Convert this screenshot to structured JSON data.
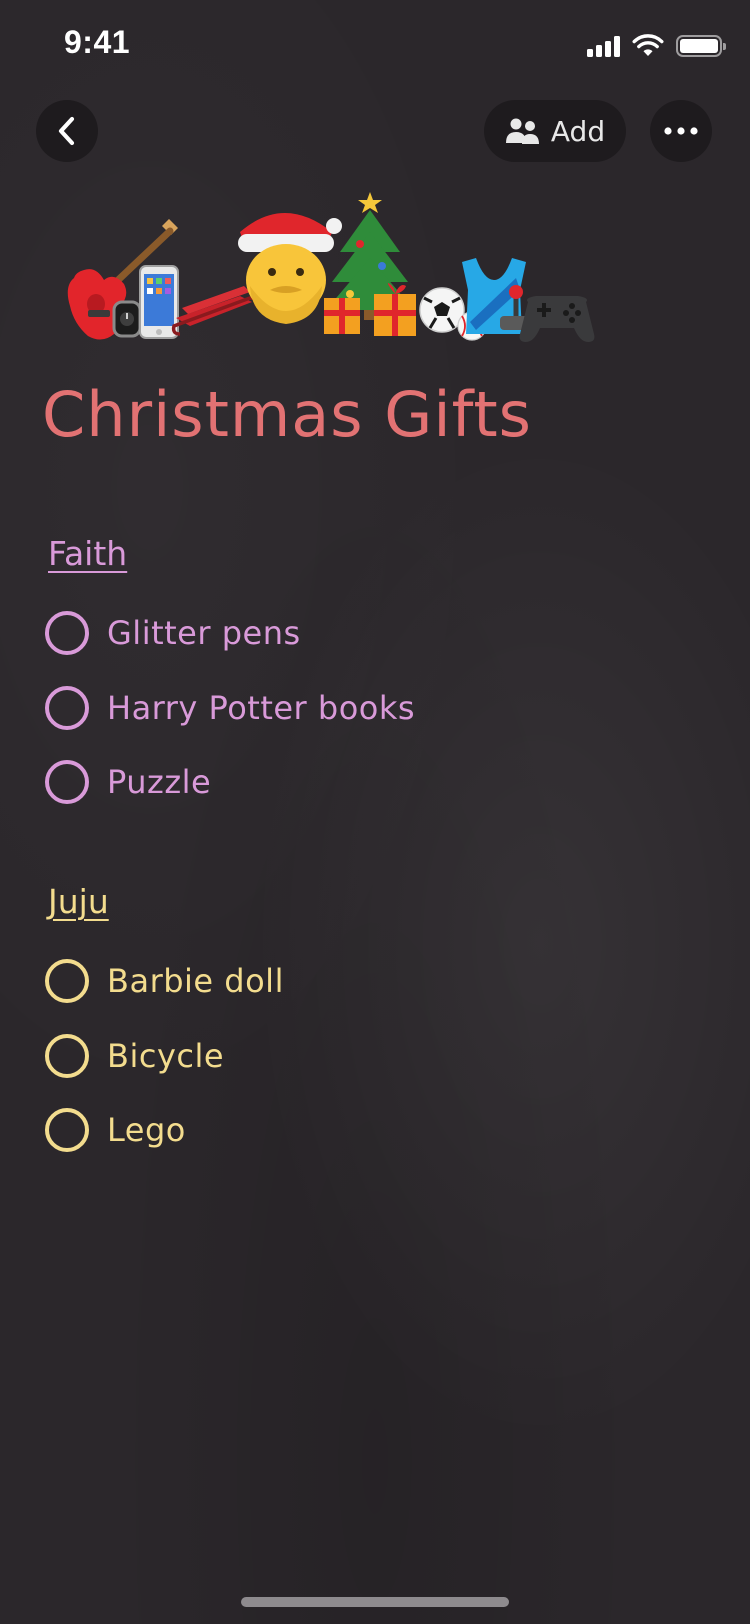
{
  "status_bar": {
    "time": "9:41"
  },
  "nav": {
    "back_icon": "chevron-left-icon",
    "add_icon": "people-icon",
    "add_label": "Add",
    "more_icon": "ellipsis-icon"
  },
  "banner": {
    "emojis": [
      "guitar",
      "watch",
      "mobile-phone",
      "sled",
      "santa-face",
      "christmas-tree",
      "wrapped-gifts",
      "soccer-ball",
      "baseball",
      "tank-top",
      "joystick",
      "video-game-controller"
    ]
  },
  "note": {
    "title": "Christmas Gifts",
    "colors": {
      "title": "#e27273",
      "faith": "#d99ad9",
      "juju": "#f3dc8e",
      "background": "#2b272b"
    },
    "sections": [
      {
        "header": "Faith",
        "items": [
          "Glitter pens",
          "Harry Potter books",
          "Puzzle"
        ]
      },
      {
        "header": "Juju",
        "items": [
          "Barbie doll",
          "Bicycle",
          "Lego"
        ]
      }
    ]
  }
}
